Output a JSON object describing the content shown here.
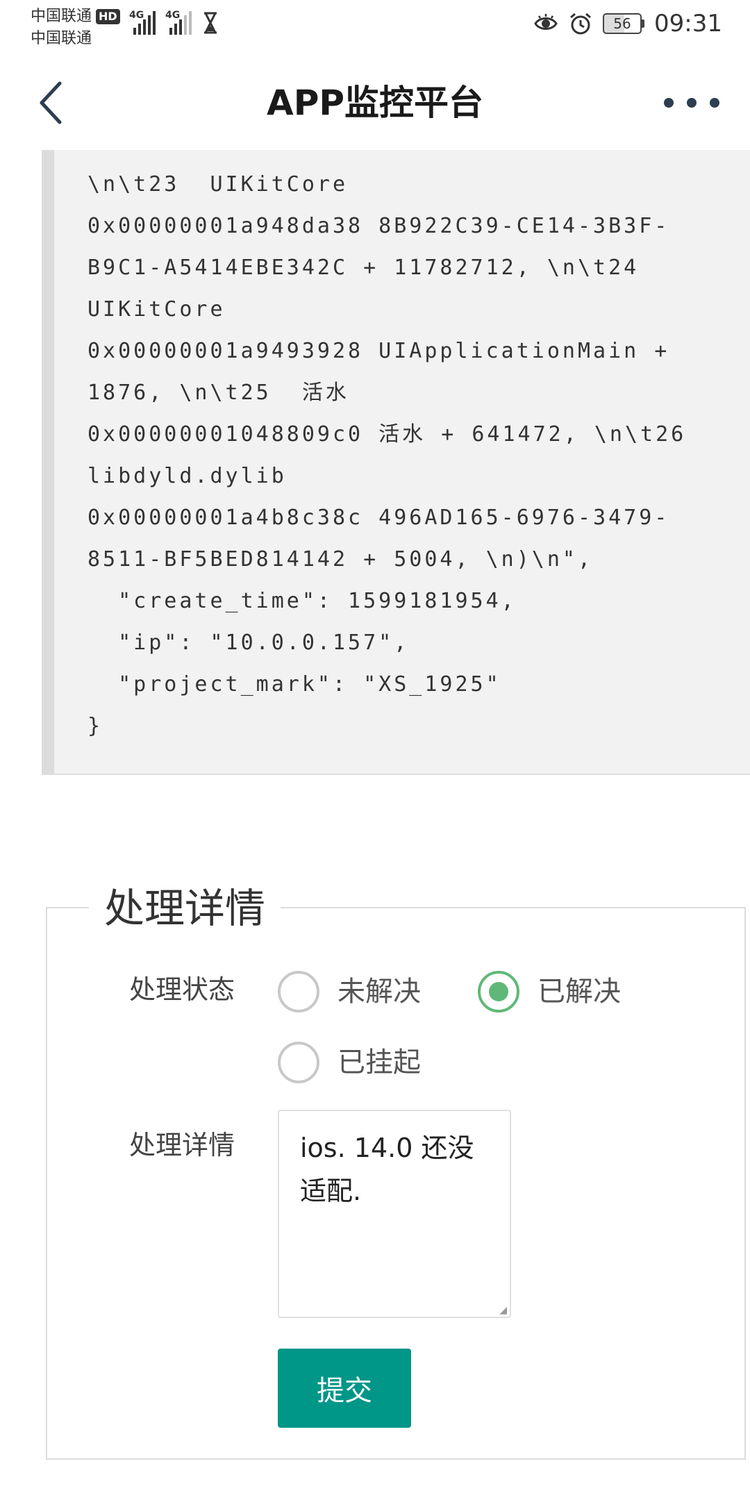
{
  "status_bar": {
    "carrier_1": "中国联通",
    "carrier_1_badge": "HD",
    "carrier_2": "中国联通",
    "network_1": "4G",
    "network_2": "4G",
    "battery": "56",
    "time": "09:31"
  },
  "header": {
    "title": "APP监控平台"
  },
  "code_block": {
    "lines": [
      "\\n\\t23  UIKitCore",
      "0x00000001a948da38 8B922C39-CE14-3B3F-",
      "B9C1-A5414EBE342C + 11782712, \\n\\t24",
      "UIKitCore",
      "0x00000001a9493928 UIApplicationMain +",
      "1876, \\n\\t25  活水",
      "0x00000001048809c0 活水 + 641472, \\n\\t26",
      "libdyld.dylib",
      "0x00000001a4b8c38c 496AD165-6976-3479-",
      "8511-BF5BED814142 + 5004, \\n)\\n\",",
      "  \"create_time\": 1599181954,",
      "  \"ip\": \"10.0.0.157\",",
      "  \"project_mark\": \"XS_1925\"",
      "}"
    ]
  },
  "detail_panel": {
    "legend": "处理详情",
    "status_label": "处理状态",
    "status_options": {
      "unresolved": "未解决",
      "resolved": "已解决",
      "suspended": "已挂起"
    },
    "status_selected": "已解决",
    "details_label": "处理详情",
    "details_value": "ios. 14.0 还没适配.",
    "submit_label": "提交"
  }
}
